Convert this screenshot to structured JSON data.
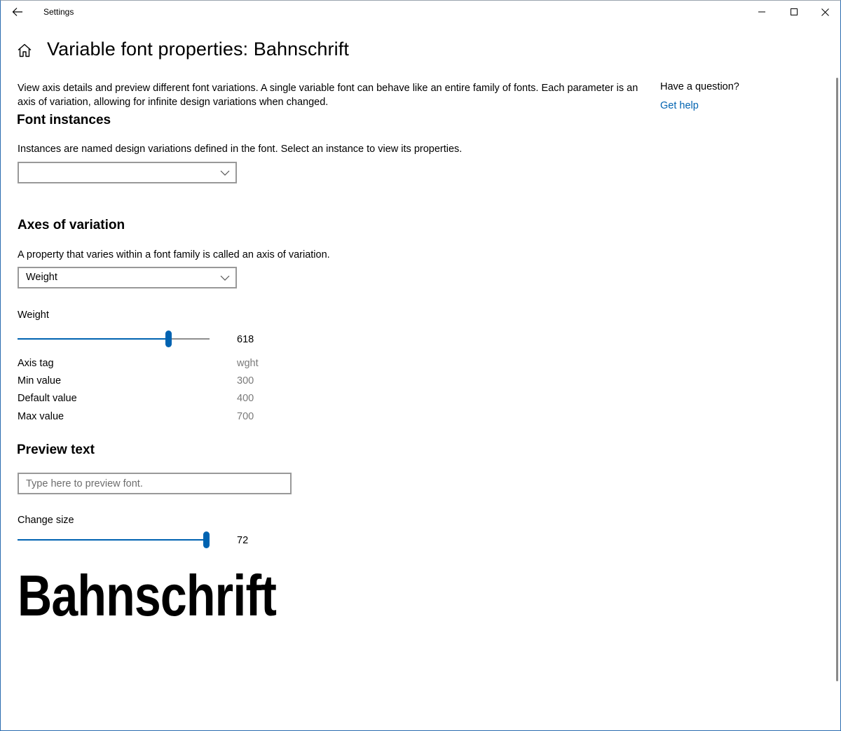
{
  "window": {
    "app_title": "Settings"
  },
  "header": {
    "page_title": "Variable font properties: Bahnschrift"
  },
  "description": "View axis details and preview different font variations. A single variable font can behave like an entire family of fonts. Each parameter is an axis of variation, allowing for infinite design variations when changed.",
  "help": {
    "question": "Have a question?",
    "link_label": "Get help"
  },
  "font_instances": {
    "title": "Font instances",
    "description": "Instances are named design variations defined in the font. Select an instance to view its properties.",
    "selected": ""
  },
  "axes": {
    "title": "Axes of variation",
    "description": "A property that varies within a font family is called an axis of variation.",
    "selected": "Weight",
    "slider_label": "Weight",
    "slider_value": "618",
    "slider_min": 300,
    "slider_max": 700,
    "properties": [
      {
        "label": "Axis tag",
        "value": "wght"
      },
      {
        "label": "Min value",
        "value": "300"
      },
      {
        "label": "Default value",
        "value": "400"
      },
      {
        "label": "Max value",
        "value": "700"
      }
    ]
  },
  "preview": {
    "title": "Preview text",
    "placeholder": "Type here to preview font.",
    "size_label": "Change size",
    "size_value": "72",
    "size_fraction": 1.0,
    "sample_text": "Bahnschrift"
  },
  "colors": {
    "accent": "#0063b1",
    "link": "#0063b1",
    "muted_text": "#7a7a7a",
    "border": "#999999"
  }
}
